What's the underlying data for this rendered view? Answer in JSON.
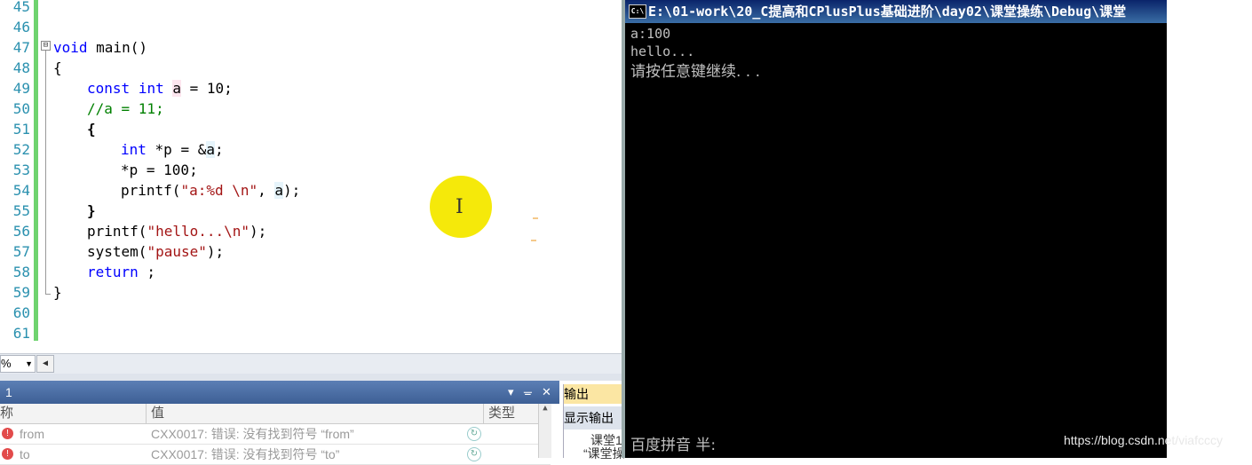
{
  "editor": {
    "line_numbers": [
      "45",
      "46",
      "47",
      "48",
      "49",
      "50",
      "51",
      "52",
      "53",
      "54",
      "55",
      "56",
      "57",
      "58",
      "59",
      "60",
      "61"
    ],
    "code": {
      "l47_kw": "void",
      "l47_rest": " main()",
      "l48": "{",
      "l49_kw1": "const",
      "l49_kw2": "int",
      "l49_var": "a",
      "l49_rest": " = 10;",
      "l50": "//a = 11;",
      "l51": "{",
      "l52_kw": "int",
      "l52_rest1": " *p = &",
      "l52_var": "a",
      "l52_rest2": ";",
      "l53": "*p = 100;",
      "l54_fn": "printf(",
      "l54_str": "\"a:%d \\n\"",
      "l54_mid": ", ",
      "l54_var": "a",
      "l54_end": ");",
      "l55": "}",
      "l56_fn": "printf(",
      "l56_str": "\"hello...\\n\"",
      "l56_end": ");",
      "l57_fn": "system(",
      "l57_str": "\"pause\"",
      "l57_end": ");",
      "l58_kw": "return",
      "l58_rest": " ;",
      "l59": "}"
    },
    "fold_glyph": "⊟",
    "zoom_value": "%",
    "ibeam_glyph": "I"
  },
  "watch": {
    "title": "1",
    "controls": {
      "pin": "▾",
      "dock": "ᚚ",
      "close": "✕"
    },
    "columns": {
      "name": "称",
      "value": "值",
      "type": "类型"
    },
    "rows": [
      {
        "name": "from",
        "value": "CXX0017: 错误: 没有找到符号 “from”"
      },
      {
        "name": "to",
        "value": "CXX0017: 错误: 没有找到符号 “to”"
      }
    ]
  },
  "output": {
    "tab": "输出",
    "show_label": "显示输出",
    "lines": [
      "课堂1",
      "“课堂操"
    ]
  },
  "console": {
    "title": "E:\\01-work\\20_C提高和CPlusPlus基础进阶\\day02\\课堂操练\\Debug\\课堂",
    "icon_text": "C:\\",
    "lines": [
      "a:100",
      "hello...",
      "请按任意键继续. . ."
    ],
    "ime": "百度拼音 半:"
  },
  "watermark": "https://blog.csdn.net/viafcccy",
  "colors": {
    "keyword": "#0000ff",
    "string": "#a31515",
    "comment": "#008000",
    "line_number": "#2b91af",
    "console_bg": "#000000",
    "console_text": "#c0c0c0",
    "highlight": "#f5e90a"
  }
}
